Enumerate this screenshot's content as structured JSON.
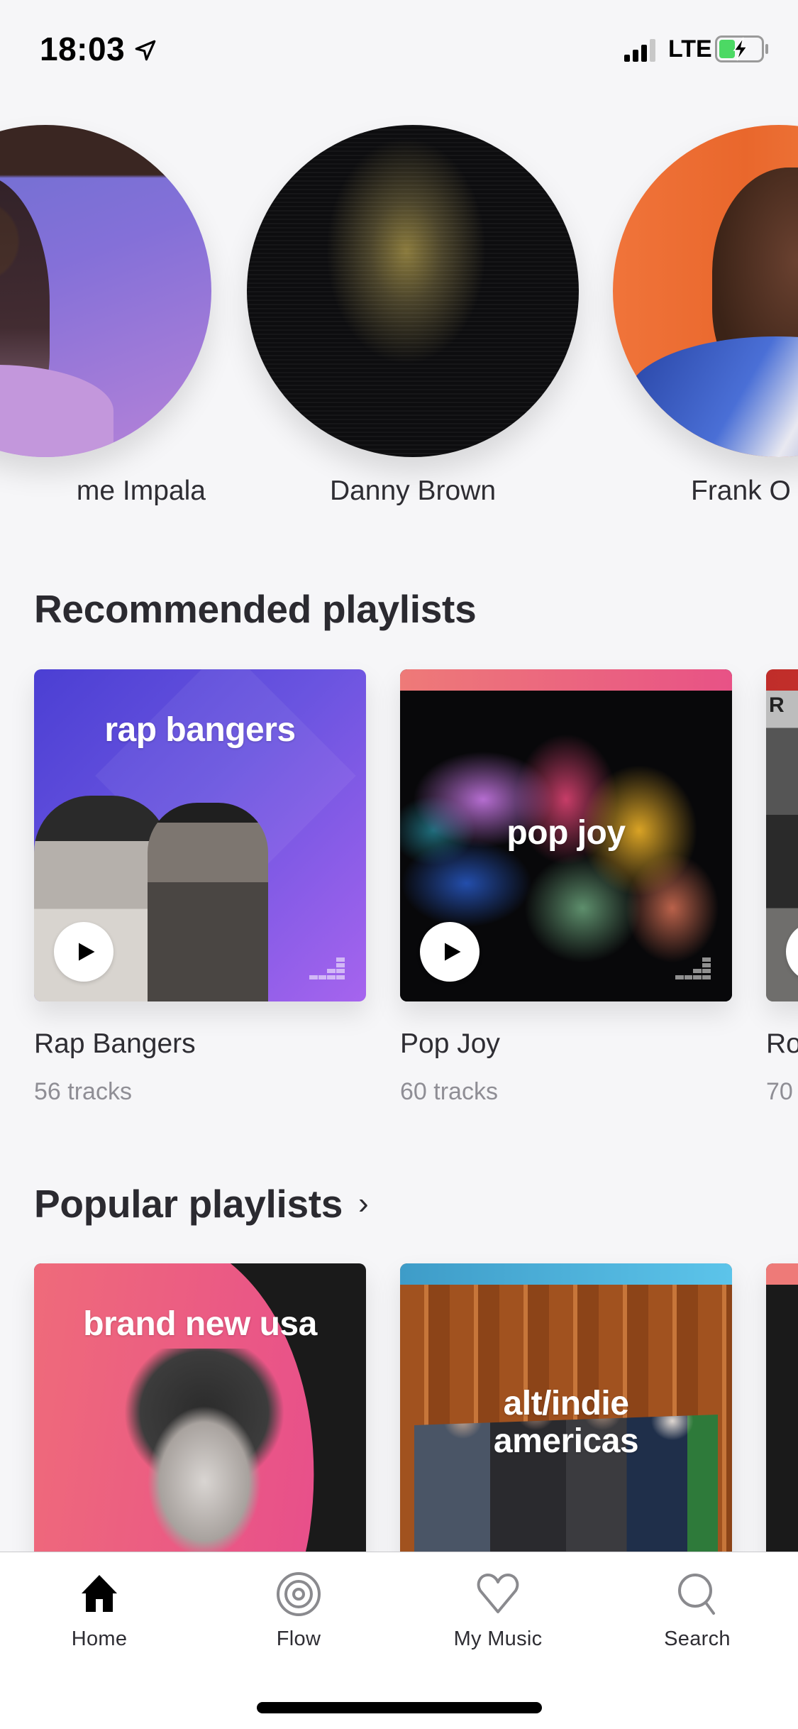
{
  "status_bar": {
    "time": "18:03",
    "network": "LTE",
    "icons": [
      "location-arrow-icon",
      "signal-icon",
      "battery-charging-icon"
    ]
  },
  "artists": [
    {
      "name": "Tame Impala",
      "visible_name": "me Impala"
    },
    {
      "name": "Danny Brown",
      "visible_name": "Danny Brown"
    },
    {
      "name": "Frank Ocean",
      "visible_name": "Frank O"
    }
  ],
  "recommended": {
    "title": "Recommended playlists",
    "items": [
      {
        "cover_text": "rap bangers",
        "title": "Rap Bangers",
        "subtitle": "56 tracks"
      },
      {
        "cover_text": "pop joy",
        "title": "Pop Joy",
        "subtitle": "60 tracks"
      },
      {
        "cover_text": "R A",
        "title": "Ro",
        "subtitle": "70"
      }
    ]
  },
  "popular": {
    "title": "Popular playlists",
    "chevron": "›",
    "items": [
      {
        "cover_text": "brand new usa"
      },
      {
        "cover_text_line1": "alt/indie",
        "cover_text_line2": "americas"
      },
      {
        "cover_text": ""
      }
    ]
  },
  "tab_bar": {
    "items": [
      {
        "label": "Home",
        "icon": "home-icon",
        "active": true
      },
      {
        "label": "Flow",
        "icon": "flow-icon",
        "active": false
      },
      {
        "label": "My Music",
        "icon": "heart-icon",
        "active": false
      },
      {
        "label": "Search",
        "icon": "search-icon",
        "active": false
      }
    ]
  },
  "colors": {
    "background": "#f6f6f8",
    "text_primary": "#2b2a30",
    "text_secondary": "#8f8e95",
    "tab_active": "#000000",
    "tab_inactive": "#8a8a8e"
  }
}
